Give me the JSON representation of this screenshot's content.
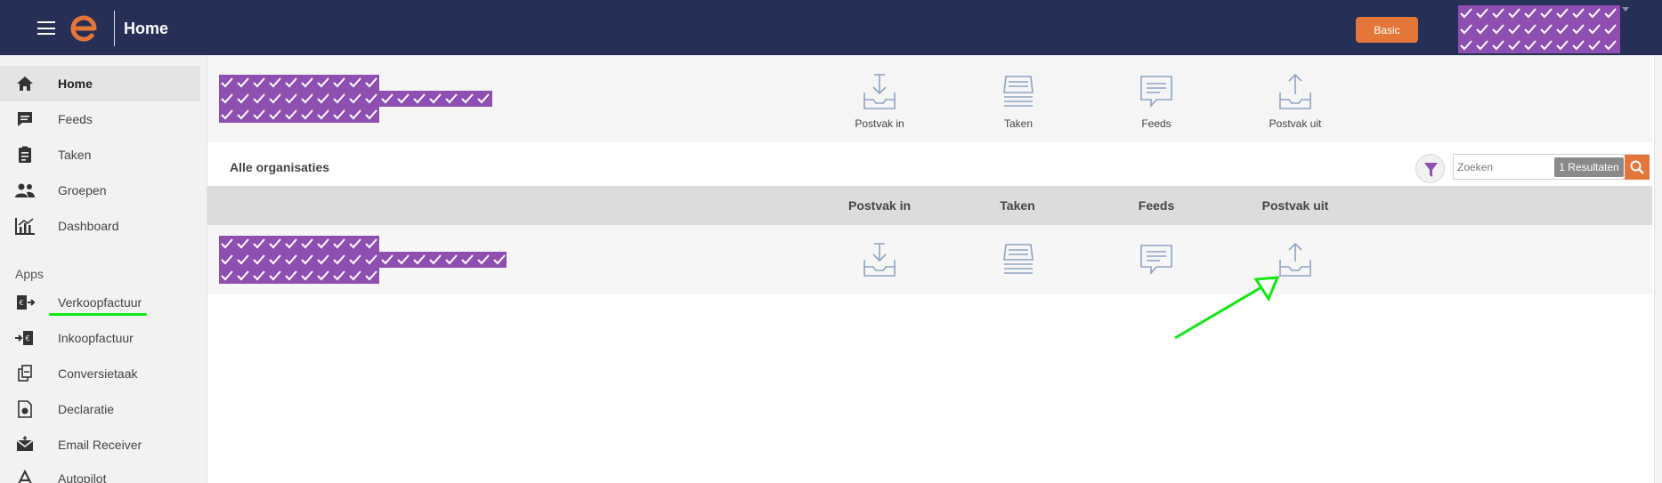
{
  "topbar": {
    "title": "Home",
    "plan_label": "Basic",
    "brand_color": "#262f55",
    "accent_color": "#e5763a",
    "logo_icon": "e-logo-icon",
    "menu_icon": "hamburger-icon"
  },
  "sidebar": {
    "items": [
      {
        "label": "Home",
        "icon": "home-icon",
        "active": true
      },
      {
        "label": "Feeds",
        "icon": "feed-icon"
      },
      {
        "label": "Taken",
        "icon": "clipboard-icon"
      },
      {
        "label": "Groepen",
        "icon": "group-icon"
      },
      {
        "label": "Dashboard",
        "icon": "chart-icon"
      }
    ],
    "apps_label": "Apps",
    "apps": [
      {
        "label": "Verkoopfactuur",
        "icon": "invoice-out-icon"
      },
      {
        "label": "Inkoopfactuur",
        "icon": "invoice-in-icon"
      },
      {
        "label": "Conversietaak",
        "icon": "conversion-icon"
      },
      {
        "label": "Declaratie",
        "icon": "expense-icon"
      },
      {
        "label": "Email Receiver",
        "icon": "email-icon"
      },
      {
        "label": "Autopilot",
        "icon": "autopilot-icon"
      }
    ]
  },
  "summary": {
    "stats": [
      {
        "label": "Postvak in",
        "icon": "inbox-icon"
      },
      {
        "label": "Taken",
        "icon": "tasks-icon"
      },
      {
        "label": "Feeds",
        "icon": "speech-bubble-icon"
      },
      {
        "label": "Postvak uit",
        "icon": "outbox-icon"
      }
    ]
  },
  "list": {
    "title": "Alle organisaties",
    "search_placeholder": "Zoeken",
    "result_count": "1 Resultaten",
    "columns": [
      "Postvak in",
      "Taken",
      "Feeds",
      "Postvak uit"
    ]
  }
}
